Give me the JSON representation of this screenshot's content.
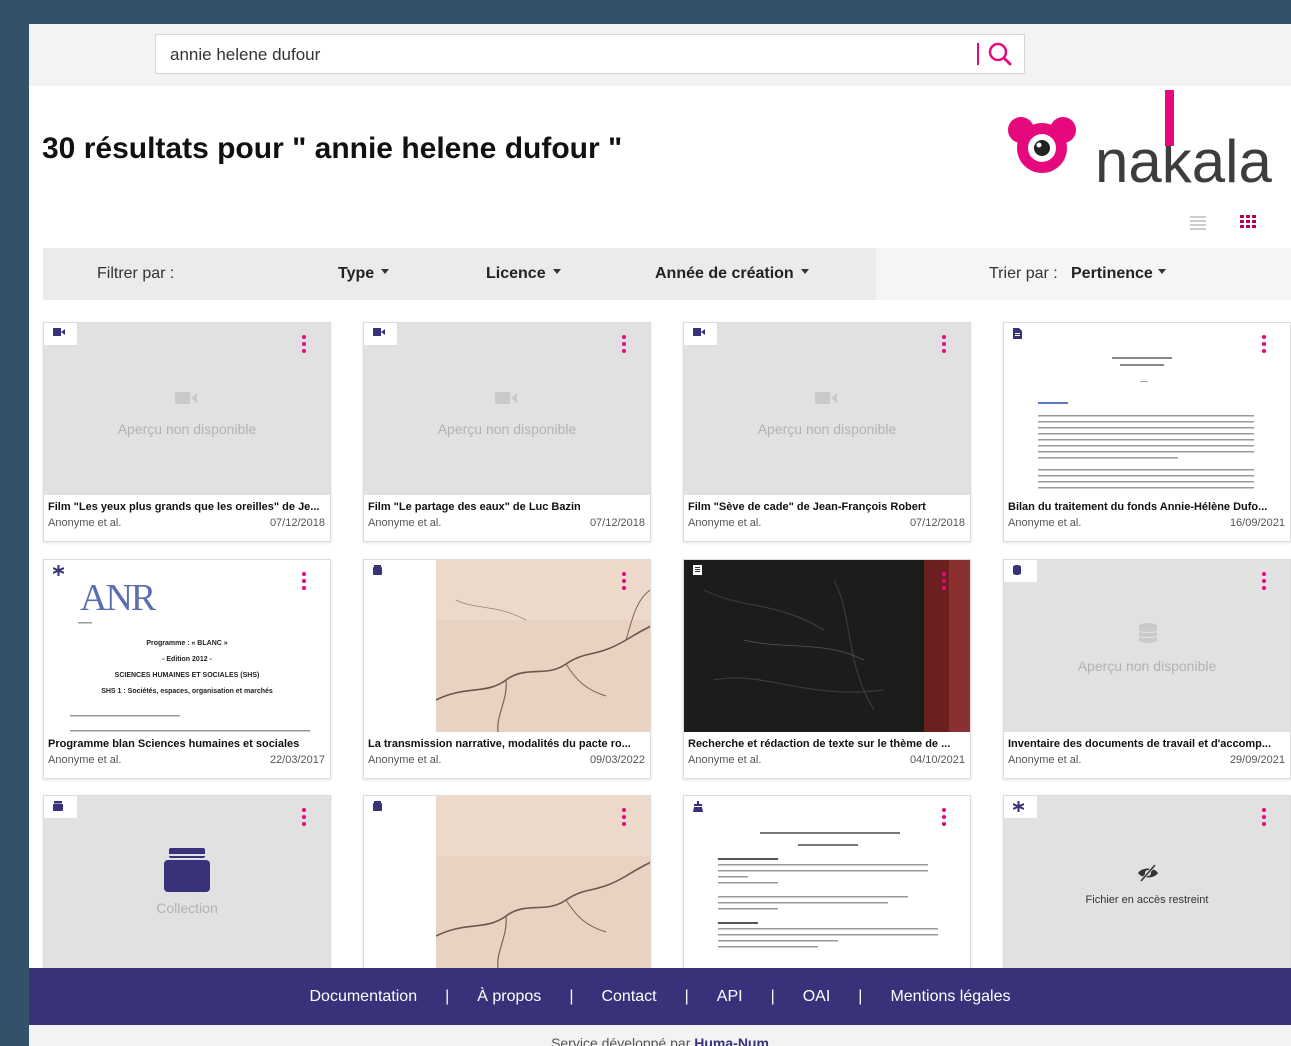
{
  "search": {
    "value": "annie helene dufour"
  },
  "results": {
    "title": "30 résultats pour \" annie helene dufour \""
  },
  "logo": {
    "text": "nakala"
  },
  "filters": {
    "label": "Filtrer par :",
    "type": "Type",
    "licence": "Licence",
    "year": "Année de création",
    "sort_label": "Trier par :",
    "sort_value": "Pertinence"
  },
  "cards": [
    {
      "title": "Film \"Les yeux plus grands que les oreilles\" de Je...",
      "author": "Anonyme et al.",
      "date": "07/12/2018",
      "preview": "Aperçu non disponible",
      "icon": "video-icon"
    },
    {
      "title": "Film \"Le partage des eaux\" de Luc Bazin",
      "author": "Anonyme et al.",
      "date": "07/12/2018",
      "preview": "Aperçu non disponible",
      "icon": "video-icon"
    },
    {
      "title": "Film \"Sève de cade\" de Jean-François Robert",
      "author": "Anonyme et al.",
      "date": "07/12/2018",
      "preview": "Aperçu non disponible",
      "icon": "video-icon"
    },
    {
      "title": "Bilan du traitement du fonds Annie-Hélène Dufo...",
      "author": "Anonyme et al.",
      "date": "16/09/2021",
      "icon": "document-icon"
    },
    {
      "title": "Programme blan Sciences humaines et sociales",
      "author": "Anonyme et al.",
      "date": "22/03/2017",
      "icon": "asterisk-icon"
    },
    {
      "title": "La transmission narrative, modalités du pacte ro...",
      "author": "Anonyme et al.",
      "date": "09/03/2022",
      "icon": "collection-icon"
    },
    {
      "title": "Recherche et rédaction de texte sur le thème de ...",
      "author": "Anonyme et al.",
      "date": "04/10/2021",
      "icon": "book-icon"
    },
    {
      "title": "Inventaire des documents de travail et d'accomp...",
      "author": "Anonyme et al.",
      "date": "29/09/2021",
      "preview": "Aperçu non disponible",
      "icon": "database-icon"
    },
    {
      "preview": "Collection",
      "icon": "collection-icon"
    },
    {
      "icon": "collection-icon"
    },
    {
      "icon": "flask-icon"
    },
    {
      "preview": "Fichier en accès restreint",
      "icon": "asterisk-icon"
    }
  ],
  "anr": {
    "logo": "ANR",
    "line1": "Programme : « BLANC »",
    "line2": "- Edition 2012 -",
    "line3": "SCIENCES HUMAINES ET SOCIALES (SHS)",
    "line4": "SHS 1 : Sociétés, espaces, organisation et marchés"
  },
  "footer": {
    "links": [
      "Documentation",
      "À propos",
      "Contact",
      "API",
      "OAI",
      "Mentions légales"
    ],
    "dev_prefix": "Service développé par",
    "dev_name": "Huma-Num"
  },
  "colors": {
    "accent": "#e6097d",
    "footer": "#37327a",
    "page_bg": "#35506a"
  }
}
